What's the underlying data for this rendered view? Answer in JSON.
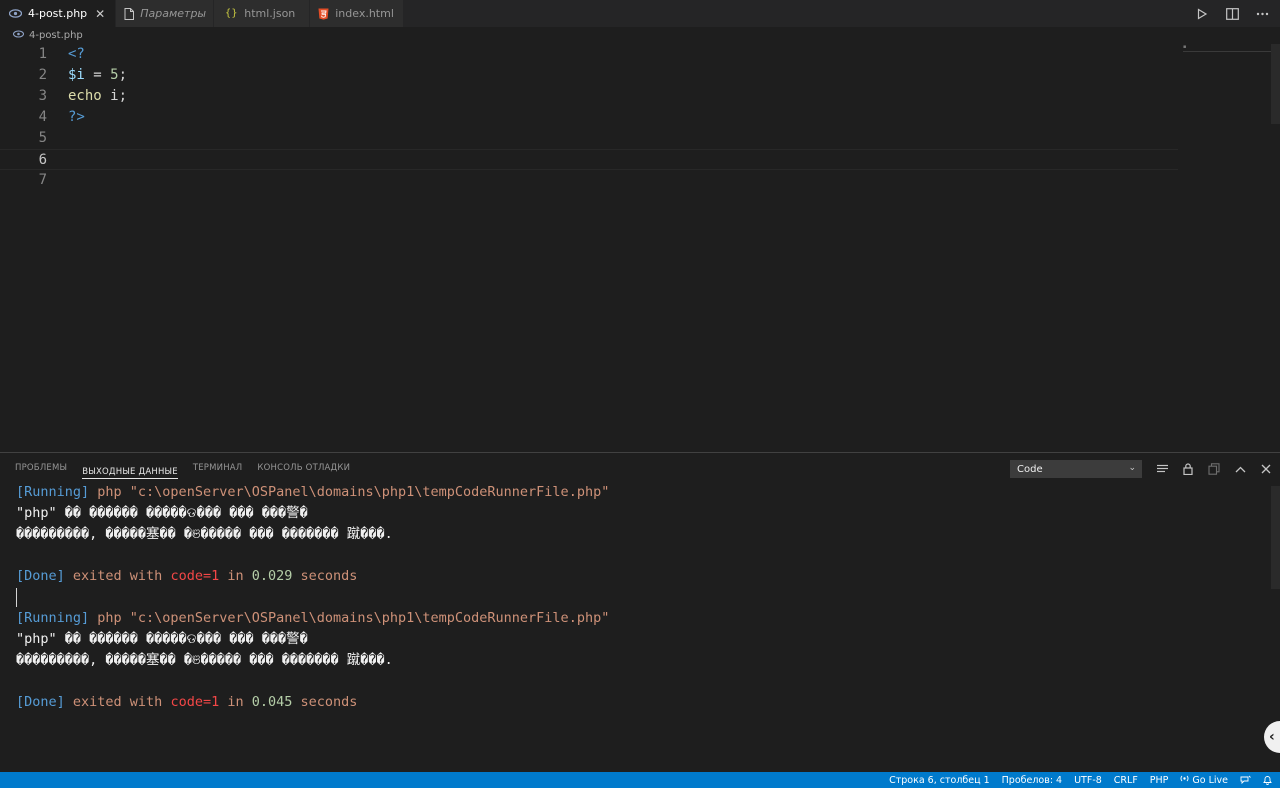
{
  "tabs": [
    {
      "label": "4-post.php",
      "icon": "php-eye-icon",
      "active": true,
      "italic": false
    },
    {
      "label": "Параметры",
      "icon": "file-icon",
      "active": false,
      "italic": true
    },
    {
      "label": "html.json",
      "icon": "json-braces-icon",
      "active": false,
      "italic": false
    },
    {
      "label": "index.html",
      "icon": "html5-icon",
      "active": false,
      "italic": false
    }
  ],
  "breadcrumb": {
    "file": "4-post.php"
  },
  "editor": {
    "line_numbers": [
      "1",
      "2",
      "3",
      "4",
      "5",
      "6",
      "7"
    ],
    "lines": [
      {
        "tokens": [
          {
            "t": "<?",
            "c": "kw"
          }
        ]
      },
      {
        "tokens": [
          {
            "t": "$i",
            "c": "var"
          },
          {
            "t": " = ",
            "c": "plain"
          },
          {
            "t": "5",
            "c": "num"
          },
          {
            "t": ";",
            "c": "plain"
          }
        ]
      },
      {
        "tokens": [
          {
            "t": "echo",
            "c": "fn"
          },
          {
            "t": " i;",
            "c": "plain"
          }
        ]
      },
      {
        "tokens": [
          {
            "t": "?>",
            "c": "kw"
          }
        ]
      },
      {
        "tokens": []
      },
      {
        "tokens": []
      },
      {
        "tokens": []
      }
    ],
    "current_line": 6
  },
  "panel": {
    "tabs": [
      {
        "label": "ПРОБЛЕМЫ",
        "active": false
      },
      {
        "label": "ВЫХОДНЫЕ ДАННЫЕ",
        "active": true
      },
      {
        "label": "ТЕРМИНАЛ",
        "active": false
      },
      {
        "label": "КОНСОЛЬ ОТЛАДКИ",
        "active": false
      }
    ],
    "output_channel": "Code",
    "output_lines": [
      [
        {
          "t": "[Running]",
          "c": "o-blue"
        },
        {
          "t": " php \"c:\\openServer\\OSPanel\\domains\\php1\\tempCodeRunnerFile.php\"",
          "c": "o-orange"
        }
      ],
      [
        {
          "t": "\"php\" �� ������ �����ଡ��� ��� ���警�",
          "c": "o-white"
        }
      ],
      [
        {
          "t": "���������, �����塞�� �ଞ����� ��� ������� 蹴���.",
          "c": "o-white"
        }
      ],
      [],
      [
        {
          "t": "[Done]",
          "c": "o-blue"
        },
        {
          "t": " exited with ",
          "c": "o-orange"
        },
        {
          "t": "code=1",
          "c": "o-red"
        },
        {
          "t": " in ",
          "c": "o-orange"
        },
        {
          "t": "0.029",
          "c": "o-green"
        },
        {
          "t": " seconds",
          "c": "o-orange"
        }
      ],
      [],
      [
        {
          "t": "[Running]",
          "c": "o-blue"
        },
        {
          "t": " php \"c:\\openServer\\OSPanel\\domains\\php1\\tempCodeRunnerFile.php\"",
          "c": "o-orange"
        }
      ],
      [
        {
          "t": "\"php\" �� ������ �����ଡ��� ��� ���警�",
          "c": "o-white"
        }
      ],
      [
        {
          "t": "���������, �����塞�� �ଞ����� ��� ������� 蹴���.",
          "c": "o-white"
        }
      ],
      [],
      [
        {
          "t": "[Done]",
          "c": "o-blue"
        },
        {
          "t": " exited with ",
          "c": "o-orange"
        },
        {
          "t": "code=1",
          "c": "o-red"
        },
        {
          "t": " in ",
          "c": "o-orange"
        },
        {
          "t": "0.045",
          "c": "o-green"
        },
        {
          "t": " seconds",
          "c": "o-orange"
        }
      ]
    ]
  },
  "statusbar": {
    "position": "Строка 6, столбец 1",
    "spaces": "Пробелов: 4",
    "encoding": "UTF-8",
    "eol": "CRLF",
    "language": "PHP",
    "go_live": "Go Live"
  },
  "colors": {
    "accent": "#007acc",
    "editor_bg": "#1e1e1e",
    "tab_bar": "#252526"
  }
}
